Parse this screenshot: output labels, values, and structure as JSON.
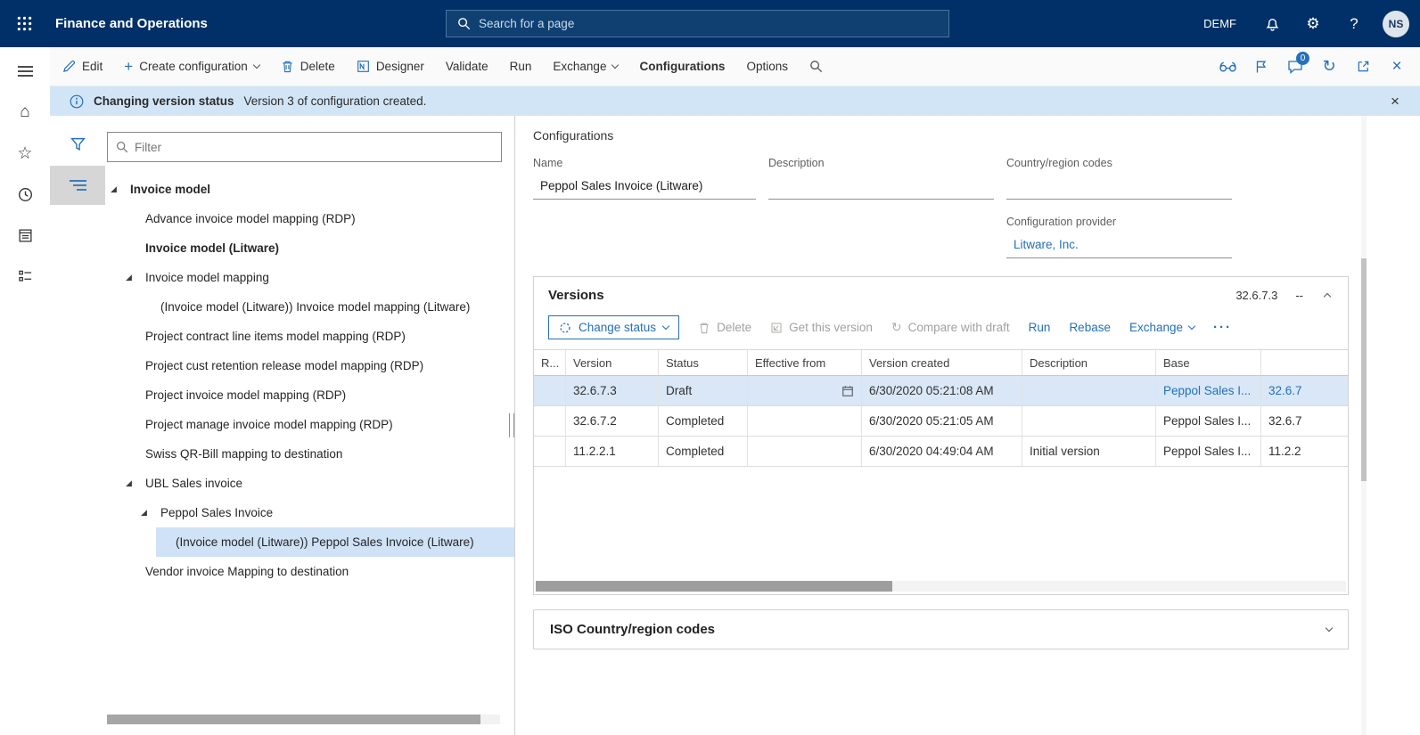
{
  "colors": {
    "header_bg": "#003067",
    "accent_blue": "#2470ba",
    "info_bar_bg": "#d2e5f7",
    "selected_row_bg": "#d9e7f7",
    "tree_selected_bg": "#cfe2f6"
  },
  "topbar": {
    "app_title": "Finance and Operations",
    "search_placeholder": "Search for a page",
    "company": "DEMF",
    "user_initials": "NS"
  },
  "actionbar": {
    "edit": "Edit",
    "create_configuration": "Create configuration",
    "delete": "Delete",
    "designer": "Designer",
    "validate": "Validate",
    "run": "Run",
    "exchange": "Exchange",
    "configurations": "Configurations",
    "options": "Options",
    "messages_badge": "0"
  },
  "infobar": {
    "title": "Changing version status",
    "message": "Version 3 of configuration created."
  },
  "left_panel": {
    "filter_placeholder": "Filter",
    "tree": [
      {
        "label": "Invoice model"
      },
      {
        "label": "Advance invoice model mapping (RDP)"
      },
      {
        "label": "Invoice model (Litware)"
      },
      {
        "label": "Invoice model mapping"
      },
      {
        "label": "(Invoice model (Litware)) Invoice model mapping (Litware)"
      },
      {
        "label": "Project contract line items model mapping (RDP)"
      },
      {
        "label": "Project cust retention release model mapping (RDP)"
      },
      {
        "label": "Project invoice model mapping (RDP)"
      },
      {
        "label": "Project manage invoice model mapping (RDP)"
      },
      {
        "label": "Swiss QR-Bill mapping to destination"
      },
      {
        "label": "UBL Sales invoice"
      },
      {
        "label": "Peppol Sales Invoice"
      },
      {
        "label": "(Invoice model (Litware)) Peppol Sales Invoice (Litware)"
      },
      {
        "label": "Vendor invoice Mapping to destination"
      }
    ]
  },
  "details": {
    "section_title": "Configurations",
    "name_label": "Name",
    "name_value": "Peppol Sales Invoice (Litware)",
    "description_label": "Description",
    "country_label": "Country/region codes",
    "provider_label": "Configuration provider",
    "provider_value": "Litware, Inc."
  },
  "versions": {
    "title": "Versions",
    "header_version": "32.6.7.3",
    "header_extra": "--",
    "toolbar": {
      "change_status": "Change status",
      "delete": "Delete",
      "get_this_version": "Get this version",
      "compare_with_draft": "Compare with draft",
      "run": "Run",
      "rebase": "Rebase",
      "exchange": "Exchange"
    },
    "columns": {
      "record": "R...",
      "version": "Version",
      "status": "Status",
      "effective_from": "Effective from",
      "version_created": "Version created",
      "description": "Description",
      "base": "Base"
    },
    "rows": [
      {
        "version": "32.6.7.3",
        "status": "Draft",
        "effective_from": "",
        "version_created": "6/30/2020 05:21:08 AM",
        "description": "",
        "base": "Peppol Sales I...",
        "base_version": "32.6.7"
      },
      {
        "version": "32.6.7.2",
        "status": "Completed",
        "effective_from": "",
        "version_created": "6/30/2020 05:21:05 AM",
        "description": "",
        "base": "Peppol Sales I...",
        "base_version": "32.6.7"
      },
      {
        "version": "11.2.2.1",
        "status": "Completed",
        "effective_from": "",
        "version_created": "6/30/2020 04:49:04 AM",
        "description": "Initial version",
        "base": "Peppol Sales I...",
        "base_version": "11.2.2"
      }
    ]
  },
  "iso_section": {
    "title": "ISO Country/region codes"
  },
  "icons": {
    "home": "⌂",
    "star": "☆",
    "gear": "⚙",
    "help": "?",
    "close": "×",
    "refresh": "↻",
    "sync": "↻",
    "more": "···",
    "plus": "+",
    "tree_caret": "◢"
  }
}
